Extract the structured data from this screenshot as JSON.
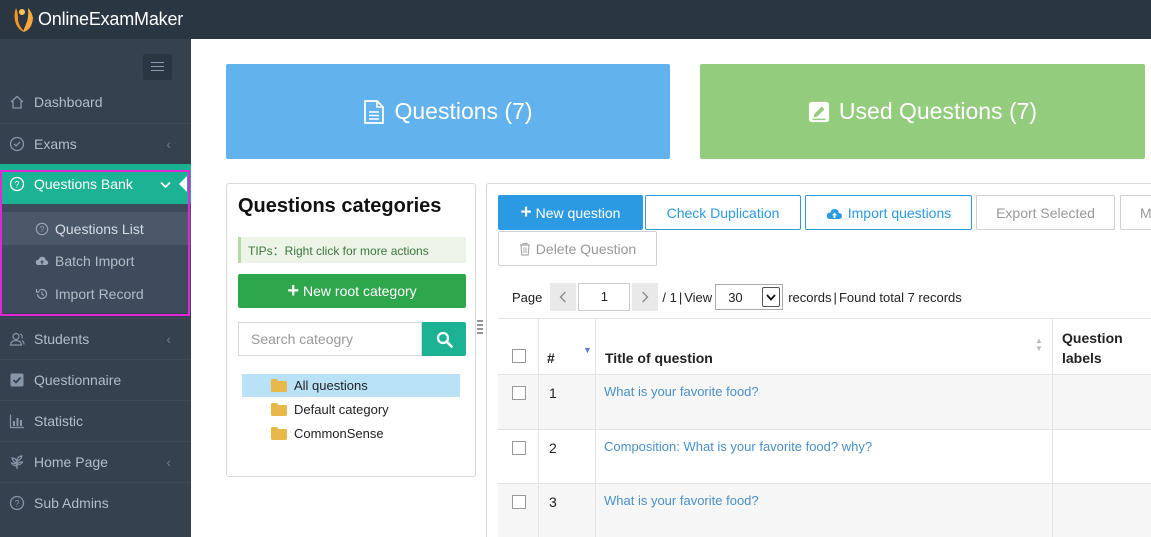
{
  "app": {
    "name": "OnlineExamMaker"
  },
  "sidebar": {
    "items": [
      {
        "label": "Dashboard",
        "icon": "home-icon",
        "has_arrow": false
      },
      {
        "label": "Exams",
        "icon": "check-circle-icon",
        "has_arrow": true
      },
      {
        "label": "Questions Bank",
        "icon": "question-circle-icon",
        "has_arrow": true,
        "active": true
      },
      {
        "label": "Students",
        "icon": "users-icon",
        "has_arrow": true
      },
      {
        "label": "Questionnaire",
        "icon": "check-square-icon",
        "has_arrow": false
      },
      {
        "label": "Statistic",
        "icon": "bar-chart-icon",
        "has_arrow": false
      },
      {
        "label": "Home Page",
        "icon": "leaf-icon",
        "has_arrow": true
      },
      {
        "label": "Sub Admins",
        "icon": "question-circle-icon",
        "has_arrow": false
      }
    ],
    "submenu": [
      {
        "label": "Questions List",
        "icon": "question-circle-icon",
        "current": true
      },
      {
        "label": "Batch Import",
        "icon": "cloud-upload-icon"
      },
      {
        "label": "Import Record",
        "icon": "history-icon"
      }
    ],
    "arrow_glyph": "‹",
    "active_arrow_glyph": "⌄"
  },
  "cards": {
    "questions": "Questions (7)",
    "used": "Used Questions (7)"
  },
  "categories": {
    "title": "Questions categories",
    "tips": "TIPs：Right click for more actions",
    "new_root": "New root category",
    "search_placeholder": "Search cateogry",
    "tree": [
      "All questions",
      "Default category",
      "CommonSense"
    ]
  },
  "toolbar": {
    "new_question": "New question",
    "check_duplication": "Check Duplication",
    "import_questions": "Import questions",
    "export_selected": "Export Selected",
    "more": "M",
    "delete_question": "Delete Question"
  },
  "pager": {
    "page_label": "Page",
    "page_value": "1",
    "total_pages": "/ 1",
    "view_label": "View",
    "view_value": "30",
    "records_label": "records",
    "found_total": "Found total 7 records"
  },
  "table": {
    "headers": {
      "num": "#",
      "title": "Title of question",
      "labels_line1": "Question",
      "labels_line2": "labels"
    },
    "rows": [
      {
        "num": "1",
        "title": "What is your favorite food?"
      },
      {
        "num": "2",
        "title": "Composition: What is your favorite food? why?"
      },
      {
        "num": "3",
        "title": "What is your favorite food?"
      }
    ]
  },
  "colors": {
    "topbar": "#2b3643",
    "sidebar": "#364150",
    "active": "#1bb394",
    "highlight": "#e128d9",
    "card_questions": "#62b3ed",
    "card_used": "#93cc7d",
    "primary": "#2b9ae2",
    "green_button": "#2ea64b"
  }
}
